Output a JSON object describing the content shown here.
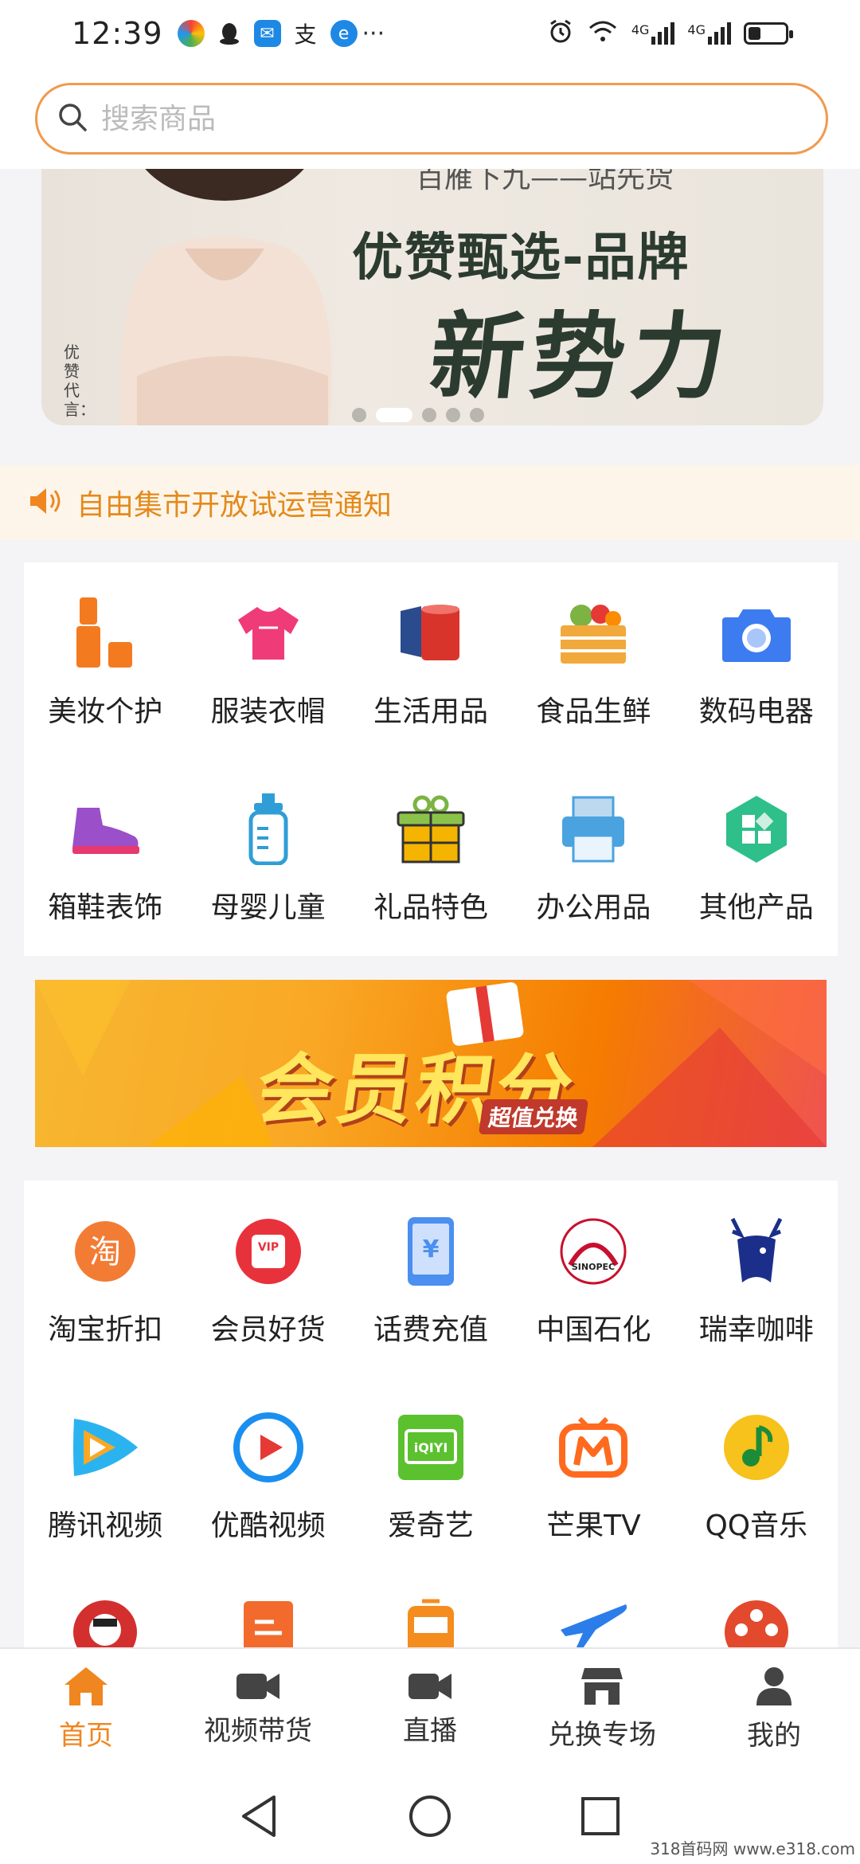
{
  "status_bar": {
    "time": "12:39",
    "more": "···",
    "network_1": "4G",
    "network_2": "4G",
    "battery_level": 0.35
  },
  "search": {
    "placeholder": "搜索商品"
  },
  "banner": {
    "top_text": "百雁下九——站先货",
    "title": "优赞甄选-品牌",
    "big_text": "新势力",
    "side_text": "优赞代言：",
    "slide_count": 5,
    "active_slide": 2
  },
  "notice": {
    "text": "自由集市开放试运营通知"
  },
  "categories": [
    {
      "label": "美妆个护",
      "icon": "lipstick-icon",
      "color": "#f47a20"
    },
    {
      "label": "服装衣帽",
      "icon": "shirt-icon",
      "color": "#ef3b78"
    },
    {
      "label": "生活用品",
      "icon": "tissue-roll-icon",
      "color": "#d9342b"
    },
    {
      "label": "食品生鲜",
      "icon": "vegetable-crate-icon",
      "color": "#f2a93b"
    },
    {
      "label": "数码电器",
      "icon": "camera-icon",
      "color": "#3c7cf0"
    },
    {
      "label": "箱鞋表饰",
      "icon": "sneaker-icon",
      "color": "#9b4fc9"
    },
    {
      "label": "母婴儿童",
      "icon": "baby-bottle-icon",
      "color": "#2f9ed6"
    },
    {
      "label": "礼品特色",
      "icon": "gift-icon",
      "color": "#f4b400"
    },
    {
      "label": "办公用品",
      "icon": "printer-icon",
      "color": "#4aa3df"
    },
    {
      "label": "其他产品",
      "icon": "grid-hexagon-icon",
      "color": "#2ebf8a"
    }
  ],
  "promo": {
    "title": "会员积分",
    "subtitle": "超值兑换"
  },
  "services": [
    {
      "label": "淘宝折扣",
      "icon": "taobao-icon",
      "color": "#f37c35",
      "glyph": "淘"
    },
    {
      "label": "会员好货",
      "icon": "vip-bag-icon",
      "color": "#e8323b",
      "glyph": "VIP"
    },
    {
      "label": "话费充值",
      "icon": "phone-recharge-icon",
      "color": "#4b8ff0",
      "glyph": "¥"
    },
    {
      "label": "中国石化",
      "icon": "sinopec-icon",
      "color": "#c8102e",
      "glyph": "SINOPEC"
    },
    {
      "label": "瑞幸咖啡",
      "icon": "luckin-deer-icon",
      "color": "#1b2f8a",
      "glyph": ""
    },
    {
      "label": "腾讯视频",
      "icon": "tencent-video-icon",
      "color": "#2bb3f0",
      "glyph": "▶"
    },
    {
      "label": "优酷视频",
      "icon": "youku-icon",
      "color": "#1a8ff0",
      "glyph": "▶"
    },
    {
      "label": "爱奇艺",
      "icon": "iqiyi-icon",
      "color": "#5bc12e",
      "glyph": "iQIYI"
    },
    {
      "label": "芒果TV",
      "icon": "mango-tv-icon",
      "color": "#ff6a1f",
      "glyph": "M"
    },
    {
      "label": "QQ音乐",
      "icon": "qq-music-icon",
      "color": "#f6c21b",
      "glyph": "♪"
    }
  ],
  "partial_icons": [
    {
      "icon": "kfc-icon",
      "color": "#d32f2f"
    },
    {
      "icon": "document-icon",
      "color": "#f26b2c"
    },
    {
      "icon": "bus-icon",
      "color": "#f48c1e"
    },
    {
      "icon": "airplane-icon",
      "color": "#2b7de9"
    },
    {
      "icon": "film-reel-icon",
      "color": "#e2492d"
    }
  ],
  "bottom_nav": [
    {
      "label": "首页",
      "icon": "home-icon",
      "active": true
    },
    {
      "label": "视频带货",
      "icon": "video-camera-icon",
      "active": false
    },
    {
      "label": "直播",
      "icon": "live-camera-icon",
      "active": false
    },
    {
      "label": "兑换专场",
      "icon": "store-icon",
      "active": false
    },
    {
      "label": "我的",
      "icon": "user-icon",
      "active": false
    }
  ],
  "colors": {
    "accent": "#f0861f",
    "notice_bg": "#fef5ea",
    "search_border": "#f19a4e"
  },
  "watermark": "318首码网 www.e318.com"
}
